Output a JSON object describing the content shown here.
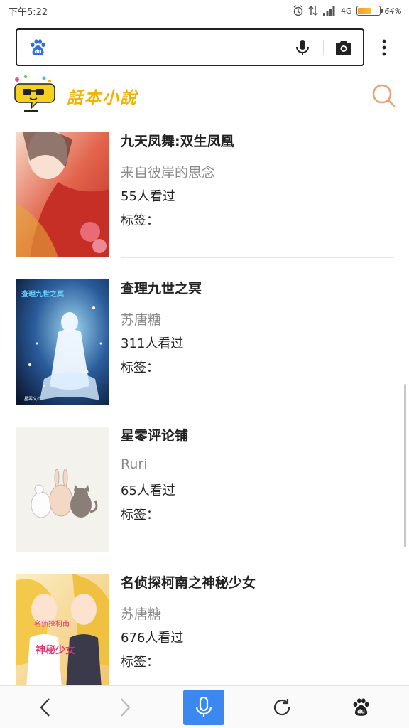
{
  "status_bar": {
    "time": "下午5:22",
    "network": "4G",
    "battery_text": "64%",
    "battery_level": 0.64
  },
  "browser": {
    "search_placeholder": "",
    "icons": [
      "baidu-paw-icon",
      "mic-icon",
      "camera-icon",
      "more-icon"
    ]
  },
  "site": {
    "logo_text": "話本小說",
    "search_icon": "search-icon",
    "accent_color": "#f0a070"
  },
  "books": [
    {
      "title": "九天凤舞:双生凤凰",
      "author": "来自彼岸的思念",
      "views": "55人看过",
      "tags_label": "标签："
    },
    {
      "title": "查理九世之冥",
      "author": "苏唐糖",
      "views": "311人看过",
      "tags_label": "标签："
    },
    {
      "title": "星零评论铺",
      "author": "Ruri",
      "views": "65人看过",
      "tags_label": "标签："
    },
    {
      "title": "名侦探柯南之神秘少女",
      "author": "苏唐糖",
      "views": "676人看过",
      "tags_label": "标签："
    }
  ],
  "cover_texts": {
    "book2_title": "查理九世之冥",
    "book2_publisher": "星零文社",
    "book4_line1": "名侦探柯南",
    "book4_line2": "神秘少女"
  },
  "bottom_nav": {
    "items": [
      "back-icon",
      "forward-icon",
      "voice-icon",
      "refresh-icon",
      "baidu-paw-icon"
    ],
    "voice_color": "#3a88f0"
  }
}
